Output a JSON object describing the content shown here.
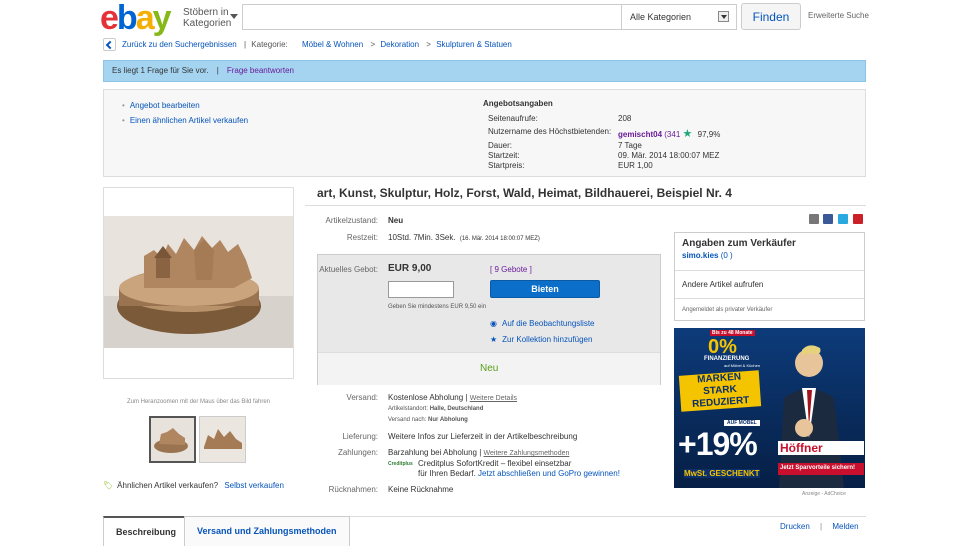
{
  "header": {
    "logo": [
      "e",
      "b",
      "a",
      "y"
    ],
    "browse": [
      "Stöbern in",
      "Kategorien"
    ],
    "search_placeholder": "",
    "category": "Alle Kategorien",
    "find": "Finden",
    "advanced": "Erweiterte Suche"
  },
  "breadcrumb": {
    "back": "Zurück zu den Suchergebnissen",
    "sep": "|",
    "category_label": "Kategorie:",
    "items": [
      "Möbel & Wohnen",
      "Dekoration",
      "Skulpturen & Statuen"
    ],
    "arrow": ">"
  },
  "question_bar": {
    "text": "Es liegt 1 Frage für Sie vor.",
    "sep": "|",
    "link": "Frage beantworten"
  },
  "seller_actions": [
    "Angebot bearbeiten",
    "Einen ähnlichen Artikel verkaufen"
  ],
  "offer_info": {
    "heading": "Angebotsangaben",
    "rows": [
      {
        "label": "Seitenaufrufe:",
        "value": "208"
      },
      {
        "label": "Nutzername des Höchstbietenden:",
        "value": "gemischt04",
        "extra": "(341",
        "rating": "97,9%"
      },
      {
        "label": "Dauer:",
        "value": "7 Tage"
      },
      {
        "label": "Startzeit:",
        "value": "09. Mär. 2014 18:00:07 MEZ"
      },
      {
        "label": "Startpreis:",
        "value": "EUR 1,00"
      }
    ],
    "star_icon": "star-icon"
  },
  "gallery": {
    "zoom_hint": "Zum Heranzoomen mit der Maus über das Bild fahren",
    "sell_similar_label": "Ähnlichen Artikel verkaufen?",
    "sell_similar_link": "Selbst verkaufen"
  },
  "item": {
    "title": "art, Kunst, Skulptur, Holz, Forst, Wald, Heimat, Bildhauerei, Beispiel Nr. 4",
    "condition_label": "Artikelzustand:",
    "condition": "Neu",
    "remaining_label": "Restzeit:",
    "remaining": "10Std. 7Min. 3Sek.",
    "remaining_date": "(16. Mär. 2014   18:00:07 MEZ)"
  },
  "bid": {
    "current_label": "Aktuelles Gebot:",
    "current": "EUR 9,00",
    "bids_link": "9 Gebote",
    "bid_open": "[",
    "bid_close": "]",
    "button": "Bieten",
    "min_hint": "Geben Sie mindestens EUR 9,50 ein",
    "watch": "Auf die Beobachtungsliste",
    "collection": "Zur Kollektion hinzufügen",
    "status": "Neu"
  },
  "shipping": {
    "label": "Versand:",
    "value": "Kostenlose Abholung",
    "sep": "|",
    "details": "Weitere Details",
    "location_label": "Artikelstandort:",
    "location": "Halle, Deutschland",
    "ship_to_label": "Versand nach:",
    "ship_to": "Nur Abholung"
  },
  "delivery": {
    "label": "Lieferung:",
    "value": "Weitere Infos zur Lieferzeit in der Artikelbeschreibung"
  },
  "payment": {
    "label": "Zahlungen:",
    "value": "Barzahlung bei Abholung",
    "sep": "|",
    "link": "Weitere Zahlungsmethoden",
    "credit_logo": "Creditplus",
    "credit_line1": "Creditplus SofortKredit – flexibel einsetzbar",
    "credit_line2a": "für Ihren Bedarf.",
    "credit_line2b": "Jetzt abschließen und GoPro gewinnen!"
  },
  "returns": {
    "label": "Rücknahmen:",
    "value": "Keine Rücknahme"
  },
  "seller": {
    "heading": "Angaben zum Verkäufer",
    "name": "simo.kies",
    "score": "(0 )",
    "other_items": "Andere Artikel aufrufen",
    "note": "Angemeldet als privater Verkäufer"
  },
  "ad": {
    "top": "Bis zu 48 Monate",
    "pct0": "0%",
    "fin": "FINANZIERUNG",
    "fin2": "auf Möbel & Küchen",
    "m1": "MARKEN",
    "m2": "STARK",
    "m3": "REDUZIERT",
    "auf": "AUF MÖBEL",
    "plus": "+19%",
    "mwst": "MwSt. GESCHENKT",
    "brand": "Höffner",
    "cta": "Jetzt Sparvorteile sichern!",
    "footer": "Anzeige - AdChoice"
  },
  "tabs": {
    "items": [
      "Beschreibung",
      "Versand und Zahlungsmethoden"
    ],
    "print": "Drucken",
    "sep": "|",
    "report": "Melden"
  },
  "colors": {
    "accent": "#0654ba",
    "bid_button": "#0b6ec8",
    "status_green": "#5a9e1b",
    "question_bg": "#a5d4f0"
  }
}
